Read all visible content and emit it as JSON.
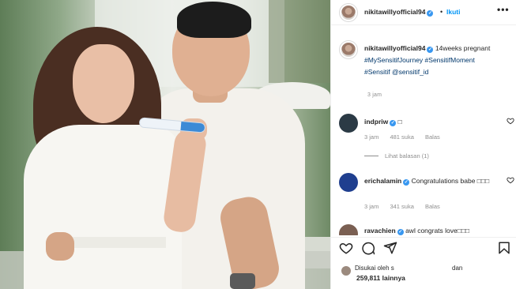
{
  "post": {
    "header": {
      "username": "nikitawillyofficial94",
      "dot": "•",
      "follow_label": "Ikuti",
      "more_label": "•••"
    },
    "caption": {
      "username": "nikitawillyofficial94",
      "text": "14weeks pregnant",
      "tags": [
        "#MySensitifJourney",
        "#SensitifMoment",
        "#Sensitif"
      ],
      "mention": "@sensitif_id",
      "time": "3 jam"
    },
    "comments": [
      {
        "username": "indpriw",
        "text": "□",
        "time": "3 jam",
        "likes": "481 suka",
        "reply": "Balas",
        "view_replies": "Lihat balasan (1)",
        "avatar_color": "#2b3a45"
      },
      {
        "username": "erichalamin",
        "text": "Congratulations babe □□□",
        "time": "3 jam",
        "likes": "341 suka",
        "reply": "Balas",
        "avatar_color": "#1f3f8f"
      },
      {
        "username": "ravachien",
        "text": "awl congrats love□□□",
        "avatar_color": "#7a5f52"
      }
    ],
    "likes": {
      "prefix": "Disukai oleh s",
      "suffix": "dan",
      "count": "259,811 lainnya"
    }
  },
  "colors": {
    "link": "#0095f6",
    "hashtag": "#00376b",
    "verified": "#3897f0",
    "muted": "#8e8e8e"
  },
  "icons": [
    "heart-icon",
    "comment-icon",
    "share-icon",
    "bookmark-icon",
    "verified-badge-icon",
    "more-options-icon"
  ]
}
